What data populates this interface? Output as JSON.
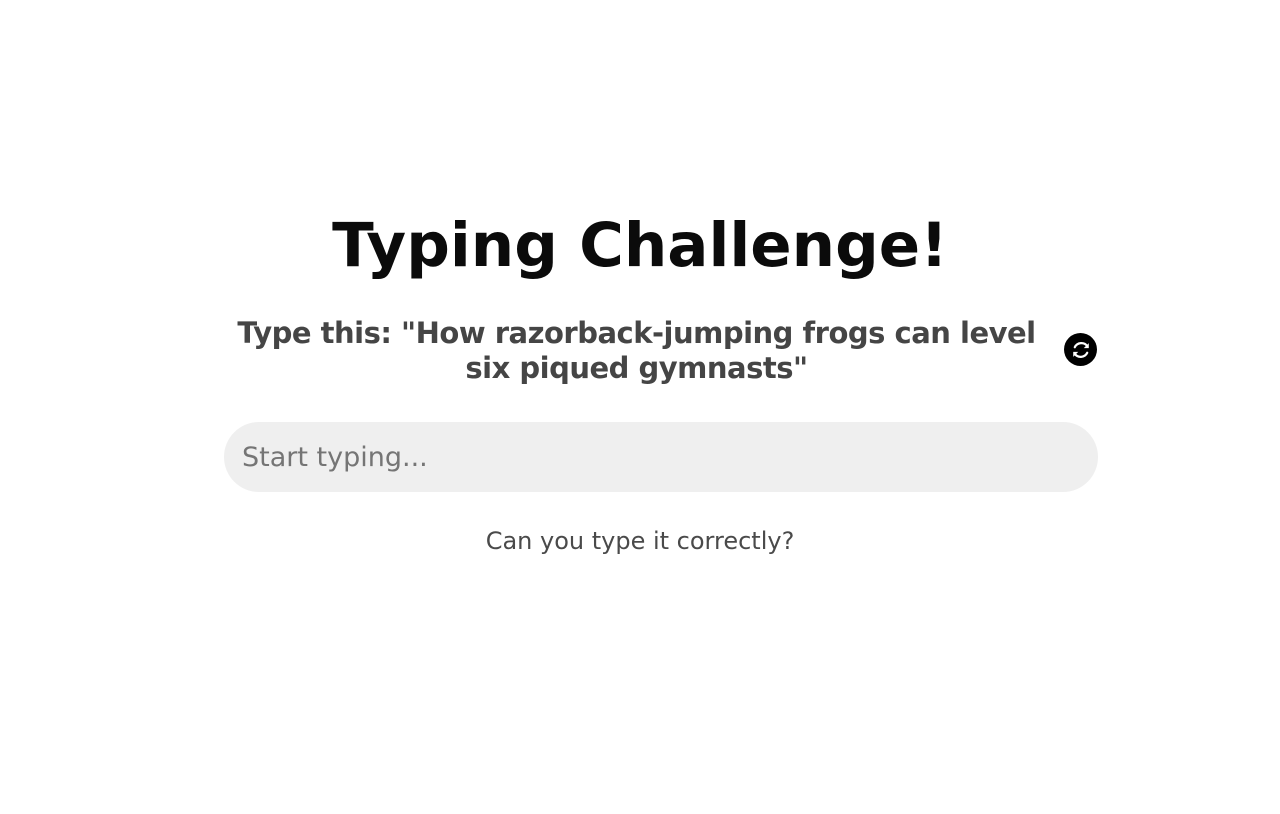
{
  "heading": {
    "title": "Typing Challenge!"
  },
  "prompt": {
    "text": "Type this: \"How razorback-jumping frogs can level six piqued gymnasts\"",
    "refresh_icon": "refresh-icon",
    "refresh_button_color": "#000000"
  },
  "input": {
    "placeholder": "Start typing...",
    "value": ""
  },
  "hint": {
    "text": "Can you type it correctly?"
  },
  "colors": {
    "title": "#0b0b0b",
    "prompt": "#454545",
    "input_background": "#efefef",
    "hint": "#4a4a4a"
  }
}
